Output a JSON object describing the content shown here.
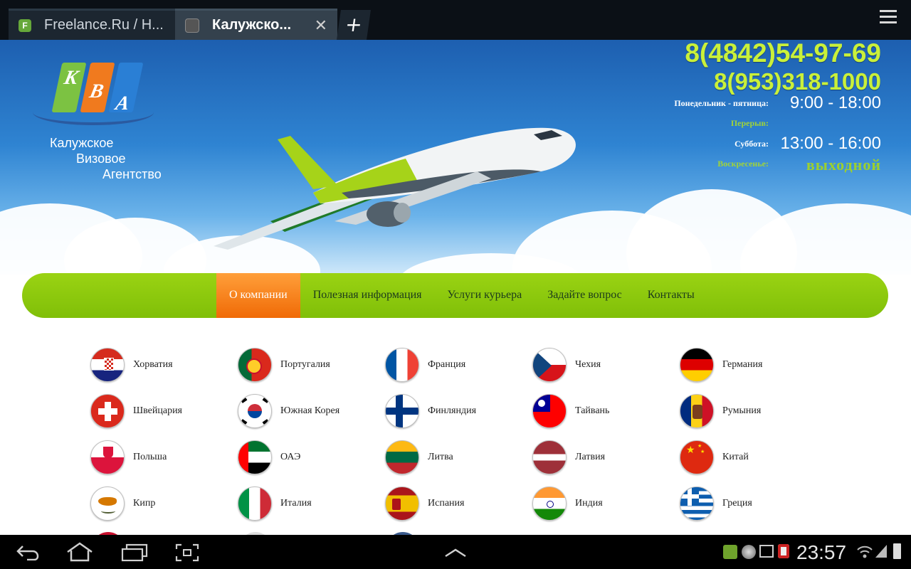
{
  "browser": {
    "tabs": [
      {
        "title": "Freelance.Ru / H...",
        "favicon": "F"
      },
      {
        "title": "Калужско...",
        "active": true
      }
    ],
    "new_tab_label": "+",
    "close_glyph": "✕"
  },
  "header": {
    "logo_letters": [
      "K",
      "B",
      "A"
    ],
    "logo_lines": [
      "Калужское",
      "Визовое",
      "Агентство"
    ],
    "phones": [
      "8(4842)54-97-69",
      "8(953)318-1000"
    ],
    "schedule": {
      "weekdays_label": "Понедельник - пятница:",
      "weekdays_time": "9:00 - 18:00",
      "break_label": "Перерыв:",
      "saturday_label": "Суббота:",
      "saturday_time": "13:00 - 16:00",
      "sunday_label": "Воскресенье:",
      "sunday_value": "выходной"
    }
  },
  "nav": {
    "items": [
      "О компании",
      "Полезная информация",
      "Услуги курьера",
      "Задайте вопрос",
      "Контакты"
    ],
    "active_index": 0
  },
  "countries": [
    [
      "Хорватия",
      "Португалия",
      "Франция",
      "Чехия",
      "Германия"
    ],
    [
      "Швейцария",
      "Южная Корея",
      "Финляндия",
      "Тайвань",
      "Румыния"
    ],
    [
      "Польша",
      "ОАЭ",
      "Литва",
      "Латвия",
      "Китай"
    ],
    [
      "Кипр",
      "Италия",
      "Испания",
      "Индия",
      "Греция"
    ]
  ],
  "system": {
    "clock": "23:57"
  },
  "colors": {
    "accent_green": "#8cc70c",
    "accent_orange": "#f47a16",
    "phone_color": "#c9f03a"
  }
}
